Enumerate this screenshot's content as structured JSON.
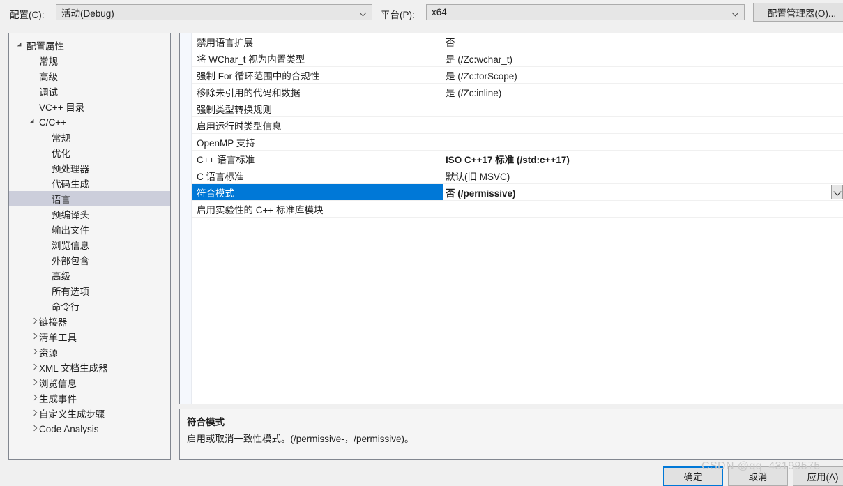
{
  "topbar": {
    "configuration_label": "配置(C):",
    "configuration_value": "活动(Debug)",
    "platform_label": "平台(P):",
    "platform_value": "x64",
    "config_manager_button": "配置管理器(O)..."
  },
  "sidebar": {
    "nodes": [
      {
        "label": "配置属性",
        "depth": 0,
        "glyph": "expanded",
        "selected": false
      },
      {
        "label": "常规",
        "depth": 1,
        "glyph": "none",
        "selected": false
      },
      {
        "label": "高级",
        "depth": 1,
        "glyph": "none",
        "selected": false
      },
      {
        "label": "调试",
        "depth": 1,
        "glyph": "none",
        "selected": false
      },
      {
        "label": "VC++ 目录",
        "depth": 1,
        "glyph": "none",
        "selected": false
      },
      {
        "label": "C/C++",
        "depth": 1,
        "glyph": "expanded",
        "selected": false
      },
      {
        "label": "常规",
        "depth": 2,
        "glyph": "none",
        "selected": false
      },
      {
        "label": "优化",
        "depth": 2,
        "glyph": "none",
        "selected": false
      },
      {
        "label": "预处理器",
        "depth": 2,
        "glyph": "none",
        "selected": false
      },
      {
        "label": "代码生成",
        "depth": 2,
        "glyph": "none",
        "selected": false
      },
      {
        "label": "语言",
        "depth": 2,
        "glyph": "none",
        "selected": true
      },
      {
        "label": "预编译头",
        "depth": 2,
        "glyph": "none",
        "selected": false
      },
      {
        "label": "输出文件",
        "depth": 2,
        "glyph": "none",
        "selected": false
      },
      {
        "label": "浏览信息",
        "depth": 2,
        "glyph": "none",
        "selected": false
      },
      {
        "label": "外部包含",
        "depth": 2,
        "glyph": "none",
        "selected": false
      },
      {
        "label": "高级",
        "depth": 2,
        "glyph": "none",
        "selected": false
      },
      {
        "label": "所有选项",
        "depth": 2,
        "glyph": "none",
        "selected": false
      },
      {
        "label": "命令行",
        "depth": 2,
        "glyph": "none",
        "selected": false
      },
      {
        "label": "链接器",
        "depth": 1,
        "glyph": "collapsed",
        "selected": false
      },
      {
        "label": "清单工具",
        "depth": 1,
        "glyph": "collapsed",
        "selected": false
      },
      {
        "label": "资源",
        "depth": 1,
        "glyph": "collapsed",
        "selected": false
      },
      {
        "label": "XML 文档生成器",
        "depth": 1,
        "glyph": "collapsed",
        "selected": false
      },
      {
        "label": "浏览信息",
        "depth": 1,
        "glyph": "collapsed",
        "selected": false
      },
      {
        "label": "生成事件",
        "depth": 1,
        "glyph": "collapsed",
        "selected": false
      },
      {
        "label": "自定义生成步骤",
        "depth": 1,
        "glyph": "collapsed",
        "selected": false
      },
      {
        "label": "Code Analysis",
        "depth": 1,
        "glyph": "collapsed",
        "selected": false
      }
    ]
  },
  "grid": {
    "rows": [
      {
        "name": "禁用语言扩展",
        "value": "否",
        "bold": false,
        "selected": false
      },
      {
        "name": "将 WChar_t 视为内置类型",
        "value": "是 (/Zc:wchar_t)",
        "bold": false,
        "selected": false
      },
      {
        "name": "强制 For 循环范围中的合规性",
        "value": "是 (/Zc:forScope)",
        "bold": false,
        "selected": false
      },
      {
        "name": "移除未引用的代码和数据",
        "value": "是 (/Zc:inline)",
        "bold": false,
        "selected": false
      },
      {
        "name": "强制类型转换规则",
        "value": "",
        "bold": false,
        "selected": false
      },
      {
        "name": "启用运行时类型信息",
        "value": "",
        "bold": false,
        "selected": false
      },
      {
        "name": "OpenMP 支持",
        "value": "",
        "bold": false,
        "selected": false
      },
      {
        "name": "C++ 语言标准",
        "value": "ISO C++17 标准 (/std:c++17)",
        "bold": true,
        "selected": false
      },
      {
        "name": "C 语言标准",
        "value": "默认(旧 MSVC)",
        "bold": false,
        "selected": false
      },
      {
        "name": "符合模式",
        "value": "否 (/permissive)",
        "bold": true,
        "selected": true
      },
      {
        "name": "启用实验性的 C++ 标准库模块",
        "value": "",
        "bold": false,
        "selected": false
      }
    ]
  },
  "description": {
    "title": "符合模式",
    "text": "启用或取消一致性模式。(/permissive-，/permissive)。"
  },
  "buttons": {
    "ok": "确定",
    "cancel": "取消",
    "apply": "应用(A)"
  },
  "watermark": "CSDN @qq_43199575",
  "colors": {
    "accent": "#0078d7",
    "tree_selection": "#cccedb",
    "dialog_bg": "#f0f0f0"
  }
}
